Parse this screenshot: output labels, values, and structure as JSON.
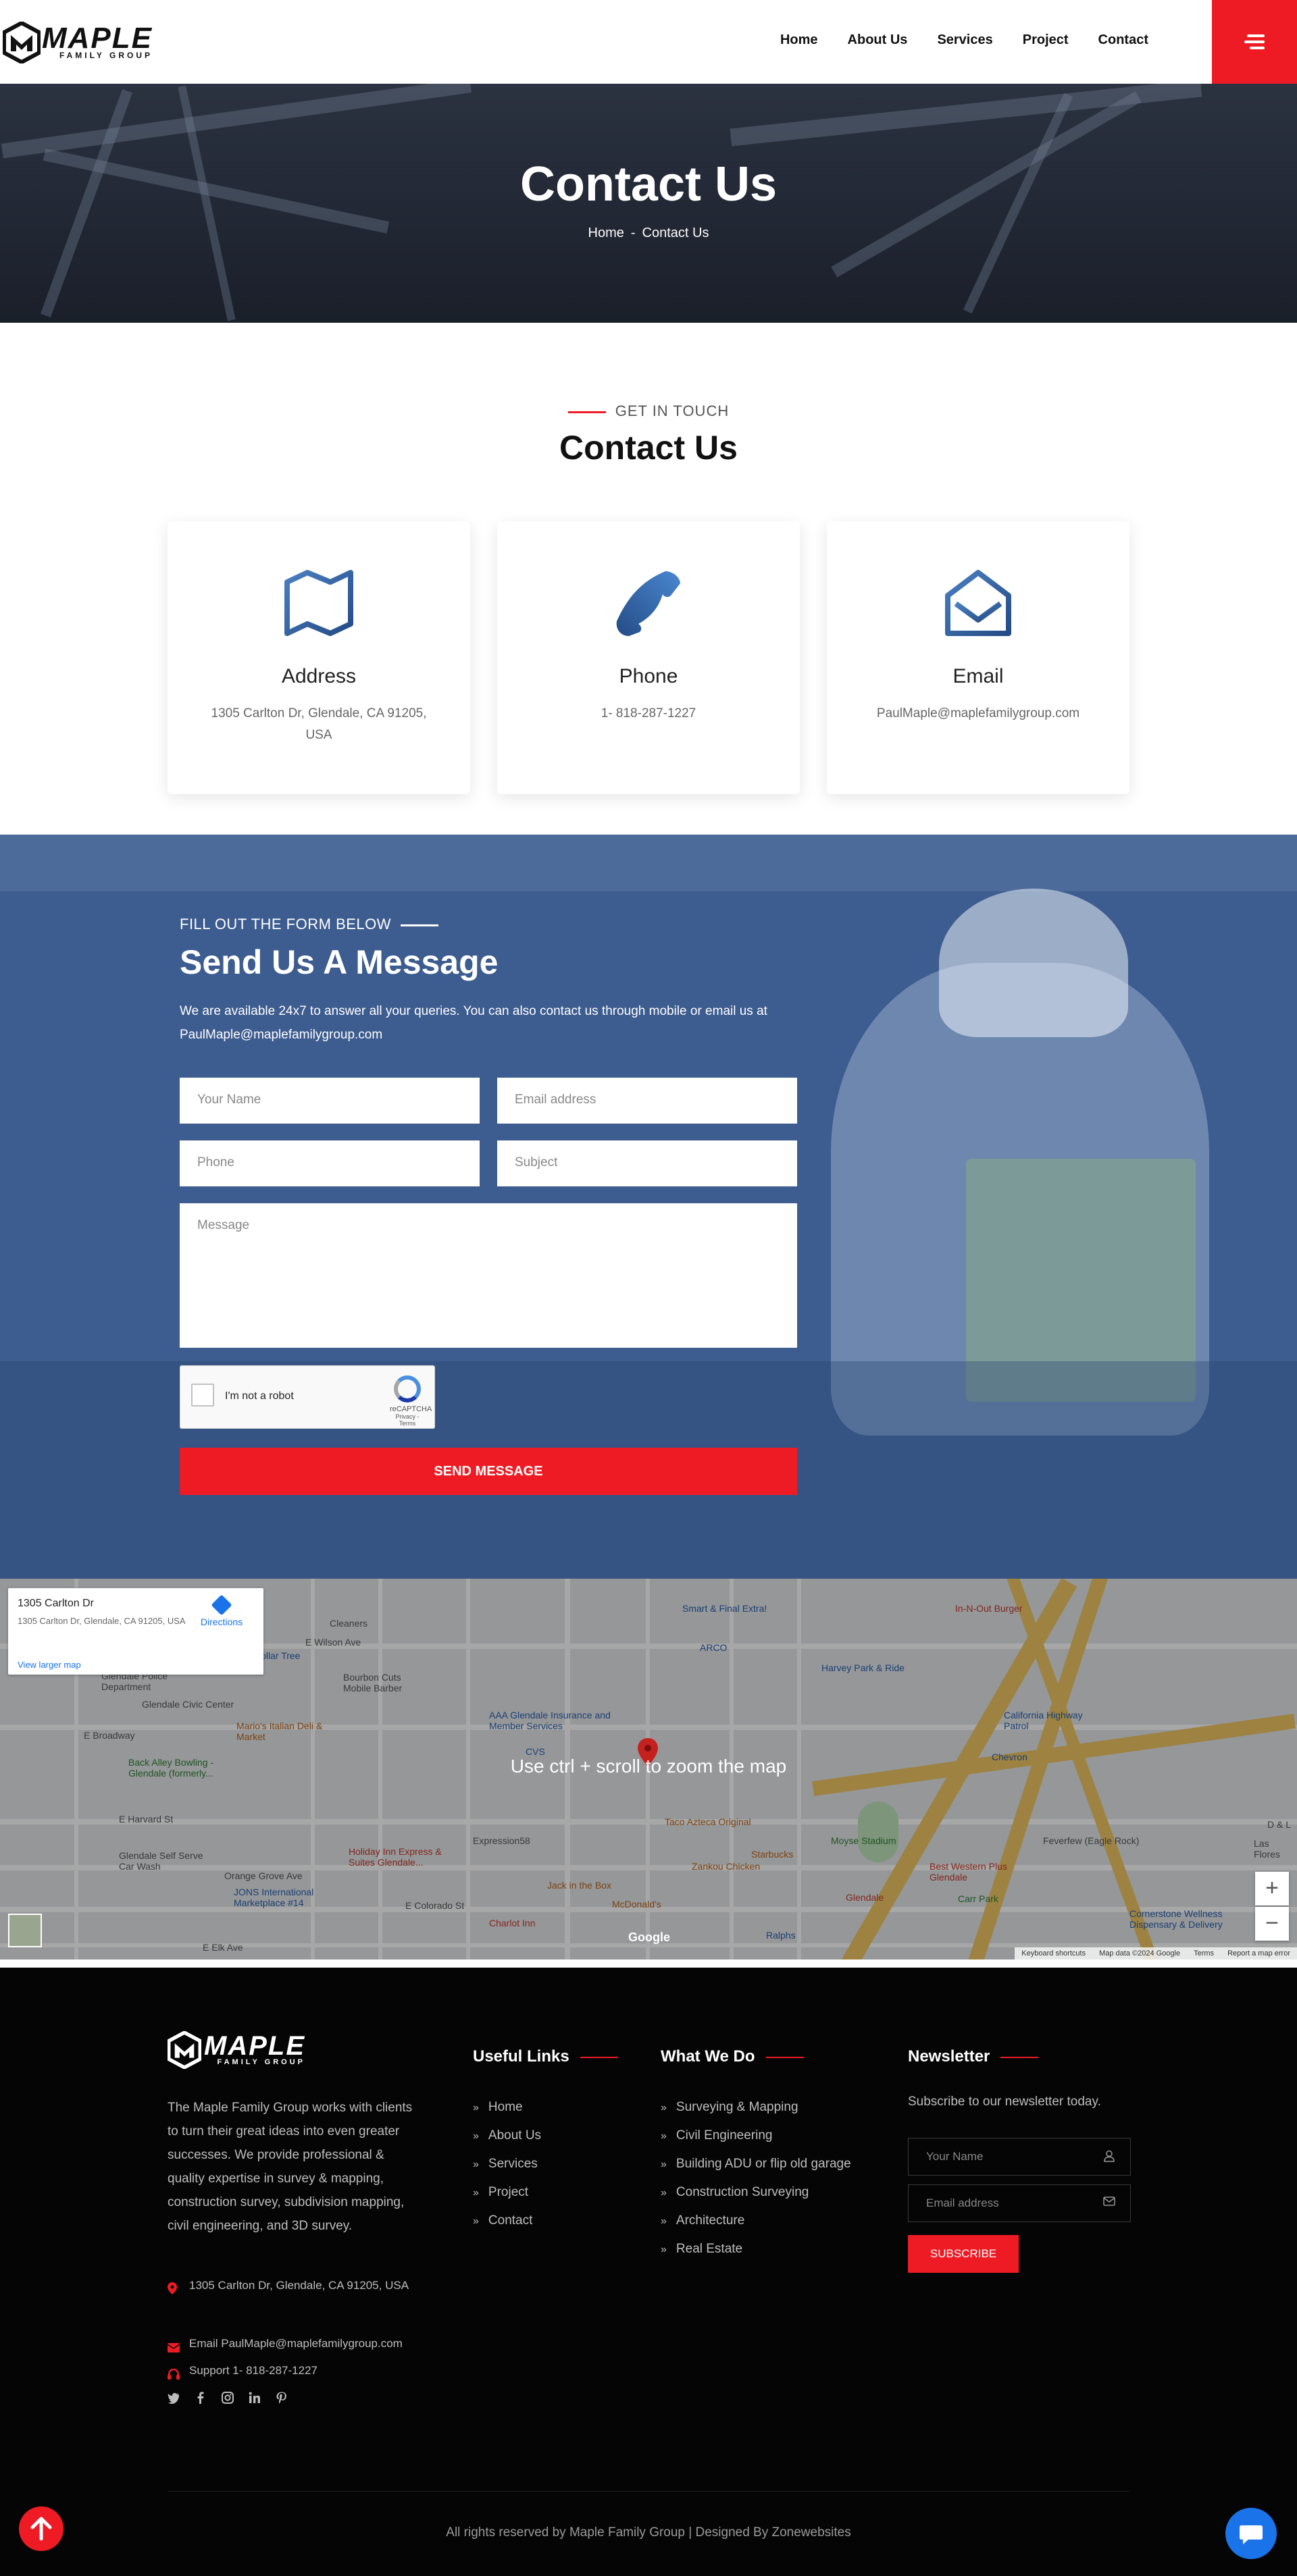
{
  "header": {
    "logo_brand": "MAPLE",
    "logo_sub": "FAMILY GROUP",
    "nav": [
      "Home",
      "About Us",
      "Services",
      "Project",
      "Contact"
    ]
  },
  "hero": {
    "title": "Contact Us",
    "breadcrumb_home": "Home",
    "breadcrumb_sep": "-",
    "breadcrumb_current": "Contact Us"
  },
  "contact": {
    "kicker": "GET IN TOUCH",
    "title": "Contact Us",
    "cards": [
      {
        "title": "Address",
        "text": "1305 Carlton Dr, Glendale, CA 91205, USA",
        "icon": "map-icon"
      },
      {
        "title": "Phone",
        "text": "1- 818-287-1227",
        "icon": "phone-icon"
      },
      {
        "title": "Email",
        "text": "PaulMaple@maplefamilygroup.com",
        "icon": "envelope-open-icon"
      }
    ]
  },
  "form": {
    "kicker": "FILL OUT THE FORM BELOW",
    "title": "Send Us A Message",
    "desc": "We are available 24x7 to answer all your queries. You can also contact us through mobile or email us at  PaulMaple@maplefamilygroup.com",
    "placeholders": {
      "name": "Your Name",
      "email": "Email address",
      "phone": "Phone",
      "subject": "Subject",
      "message": "Message"
    },
    "recaptcha_label": "I'm not a robot",
    "recaptcha_brand": "reCAPTCHA",
    "recaptcha_links": "Privacy - Terms",
    "submit": "SEND MESSAGE"
  },
  "map": {
    "overlay_message": "Use ctrl + scroll to zoom the map",
    "info_title": "1305 Carlton Dr",
    "info_address": "1305 Carlton Dr, Glendale, CA 91205, USA",
    "info_link": "View larger map",
    "directions": "Directions",
    "zoom_in": "+",
    "zoom_out": "−",
    "footer_items": [
      "Keyboard shortcuts",
      "Map data ©2024 Google",
      "Terms",
      "Report a map error"
    ],
    "google": "Google",
    "labels": [
      {
        "text": "Smart & Final Extra!",
        "cls": "blue"
      },
      {
        "text": "In-N-Out Burger",
        "cls": "red"
      },
      {
        "text": "Dollar Tree",
        "cls": "blue"
      },
      {
        "text": "Glendale Police Department",
        "cls": ""
      },
      {
        "text": "Glendale Civic Center",
        "cls": ""
      },
      {
        "text": "Mario's Italian Deli & Market",
        "cls": "orange"
      },
      {
        "text": "Back Alley Bowling - Glendale (formerly...",
        "cls": "green"
      },
      {
        "text": "Bourbon Cuts Mobile Barber",
        "cls": ""
      },
      {
        "text": "AAA Glendale Insurance and Member Services",
        "cls": "blue"
      },
      {
        "text": "ARCO",
        "cls": "blue"
      },
      {
        "text": "Harvey Park & Ride",
        "cls": "blue"
      },
      {
        "text": "California Highway Patrol",
        "cls": "blue"
      },
      {
        "text": "Chevron",
        "cls": "blue"
      },
      {
        "text": "CVS",
        "cls": "blue"
      },
      {
        "text": "Taco Azteca Original",
        "cls": "orange"
      },
      {
        "text": "Moyse Stadium",
        "cls": "green"
      },
      {
        "text": "Expression58",
        "cls": ""
      },
      {
        "text": "Glendale Self Serve Car Wash",
        "cls": ""
      },
      {
        "text": "Holiday Inn Express & Suites Glendale...",
        "cls": "red"
      },
      {
        "text": "Zankou Chicken",
        "cls": "orange"
      },
      {
        "text": "Starbucks",
        "cls": "orange"
      },
      {
        "text": "Jack in the Box",
        "cls": "orange"
      },
      {
        "text": "McDonald's",
        "cls": "orange"
      },
      {
        "text": "JONS International Marketplace #14",
        "cls": "blue"
      },
      {
        "text": "Charlot Inn",
        "cls": "red"
      },
      {
        "text": "Ralphs",
        "cls": "blue"
      },
      {
        "text": "Best Western Plus Glendale",
        "cls": "red"
      },
      {
        "text": "Glendale",
        "cls": "red"
      },
      {
        "text": "Feverfew (Eagle Rock)",
        "cls": ""
      },
      {
        "text": "Carr Park",
        "cls": "green"
      },
      {
        "text": "Cornerstone Wellness Dispensary & Delivery",
        "cls": "blue"
      },
      {
        "text": "Orange Grove Ave",
        "cls": ""
      },
      {
        "text": "E Broadway",
        "cls": ""
      },
      {
        "text": "E Wilson Ave",
        "cls": ""
      },
      {
        "text": "E Harvard St",
        "cls": ""
      },
      {
        "text": "E Colorado St",
        "cls": ""
      },
      {
        "text": "E Elk Ave",
        "cls": ""
      },
      {
        "text": "D & L",
        "cls": ""
      },
      {
        "text": "Las Flores",
        "cls": ""
      },
      {
        "text": "Cleaners",
        "cls": ""
      }
    ]
  },
  "footer": {
    "logo_brand": "MAPLE",
    "logo_sub": "FAMILY GROUP",
    "about": "The Maple Family Group works with clients to turn their great ideas into even greater successes. We provide professional & quality expertise in survey & mapping, construction survey, subdivision mapping, civil engineering, and 3D survey.",
    "address": "1305 Carlton Dr, Glendale, CA 91205, USA",
    "email": "Email PaulMaple@maplefamilygroup.com",
    "support": "Support 1- 818-287-1227",
    "useful_title": "Useful Links",
    "useful": [
      "Home",
      "About Us",
      "Services",
      "Project",
      "Contact"
    ],
    "what_title": "What We Do",
    "what": [
      "Surveying & Mapping",
      "Civil Engineering",
      "Building ADU or flip old garage",
      "Construction Surveying",
      "Architecture",
      "Real Estate"
    ],
    "newsletter_title": "Newsletter",
    "newsletter_text": "Subscribe to our newsletter today.",
    "nl_name": "Your Name",
    "nl_email": "Email address",
    "subscribe": "SUBSCRIBE",
    "copyright": "All rights reserved by Maple Family Group | Designed By Zonewebsites"
  },
  "colors": {
    "accent": "#ee1b24",
    "icon_blue": "#2f5f9e",
    "form_overlay": "#3d5c8f",
    "footer_bg": "#050505"
  }
}
